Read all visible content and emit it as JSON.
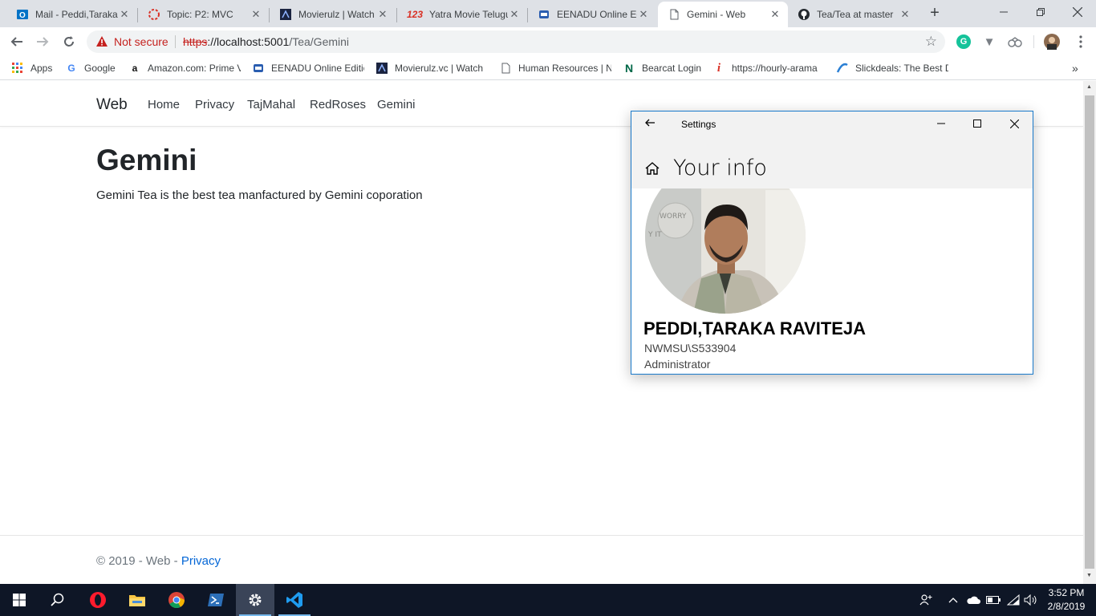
{
  "browser": {
    "tabs": [
      {
        "title": "Mail - Peddi,Taraka",
        "icon": "outlook-icon",
        "active": false
      },
      {
        "title": "Topic: P2: MVC",
        "icon": "topic-icon",
        "active": false
      },
      {
        "title": "Movierulz | Watch",
        "icon": "movierulz-icon",
        "active": false
      },
      {
        "title": "Yatra Movie Telugu",
        "icon": "123-icon",
        "active": false
      },
      {
        "title": "EENADU Online Ed",
        "icon": "eenadu-icon",
        "active": false
      },
      {
        "title": "Gemini - Web",
        "icon": "page-icon",
        "active": true
      },
      {
        "title": "Tea/Tea at master",
        "icon": "github-icon",
        "active": false
      }
    ],
    "address": {
      "security": "Not secure",
      "scheme": "https",
      "host": "://localhost:5001",
      "path": "/Tea/Gemini"
    },
    "bookmarks": [
      {
        "label": "Apps",
        "icon": "apps-grid-icon"
      },
      {
        "label": "Google",
        "icon": "google-icon"
      },
      {
        "label": "Amazon.com: Prime V",
        "icon": "amazon-icon"
      },
      {
        "label": "EENADU Online Editio",
        "icon": "eenadu-icon"
      },
      {
        "label": "Movierulz.vc | Watch",
        "icon": "movierulz-icon"
      },
      {
        "label": "Human Resources | N",
        "icon": "page-icon"
      },
      {
        "label": "Bearcat Login",
        "icon": "bearcat-icon"
      },
      {
        "label": "https://hourly-arama",
        "icon": "info-icon"
      },
      {
        "label": "Slickdeals: The Best D",
        "icon": "slickdeals-icon"
      }
    ],
    "overflow": "»"
  },
  "site": {
    "brand": "Web",
    "nav": [
      "Home",
      "Privacy",
      "TajMahal",
      "RedRoses",
      "Gemini"
    ],
    "heading": "Gemini",
    "description": "Gemini Tea is the best tea manfactured by Gemini coporation",
    "footer": {
      "prefix": "© 2019 - Web - ",
      "link": "Privacy"
    }
  },
  "settings_window": {
    "title": "Settings",
    "page_title": "Your info",
    "user_name": "PEDDI,TARAKA RAVITEJA",
    "account": "NWMSU\\S533904",
    "role": "Administrator"
  },
  "taskbar": {
    "apps": [
      "windows-start-icon",
      "search-icon",
      "opera-icon",
      "file-explorer-icon",
      "chrome-icon",
      "powershell-icon",
      "settings-gear-icon",
      "vscode-icon"
    ],
    "time": "3:52 PM",
    "date": "2/8/2019"
  },
  "colors": {
    "tabstrip": "#dee1e6",
    "not_secure": "#c5221f",
    "link": "#0366d6",
    "taskbar": "#0e1626",
    "window_border": "#1979ca"
  }
}
